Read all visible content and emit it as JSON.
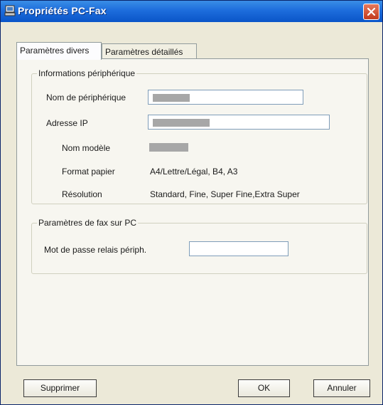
{
  "window": {
    "title": "Propriétés PC-Fax",
    "title_icon": "pc-fax-icon",
    "close_icon": "close-icon"
  },
  "tabs": [
    {
      "label": "Paramètres divers",
      "active": true
    },
    {
      "label": "Paramètres détaillés",
      "active": false
    }
  ],
  "device_info": {
    "group_label": "Informations périphérique",
    "device_name_label": "Nom de périphérique",
    "device_name_value": "",
    "ip_label": "Adresse IP",
    "ip_value": "",
    "model_label": "Nom modèle",
    "model_value": "",
    "paper_label": "Format papier",
    "paper_value": "A4/Lettre/Légal, B4, A3",
    "resolution_label": "Résolution",
    "resolution_value": "Standard, Fine, Super Fine,Extra Super"
  },
  "fax_settings": {
    "group_label": "Paramètres de fax sur PC",
    "relay_password_label": "Mot de passe relais périph.",
    "relay_password_value": ""
  },
  "buttons": {
    "delete": "Supprimer",
    "ok": "OK",
    "cancel": "Annuler"
  },
  "colors": {
    "titlebar": "#0a55c8",
    "dialog_bg": "#ece9d8",
    "close_button": "#d9562f"
  }
}
